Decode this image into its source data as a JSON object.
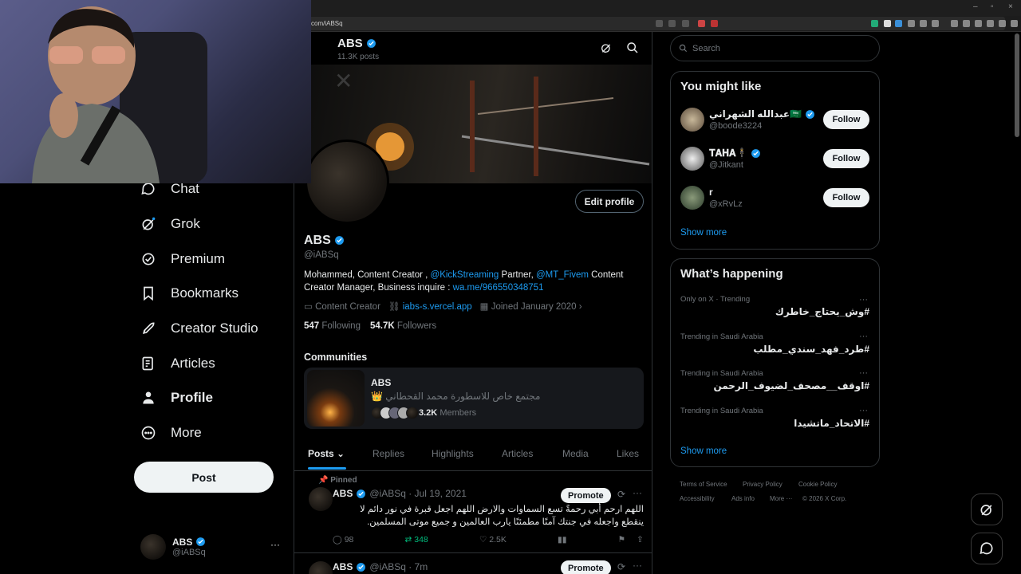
{
  "browser": {
    "url": "com/iABSq",
    "window_controls": [
      "–",
      "▫",
      "×"
    ]
  },
  "nav": {
    "items": [
      {
        "label": "Chat",
        "icon": "chat-icon"
      },
      {
        "label": "Grok",
        "icon": "grok-icon"
      },
      {
        "label": "Premium",
        "icon": "premium-icon"
      },
      {
        "label": "Bookmarks",
        "icon": "bookmark-icon"
      },
      {
        "label": "Creator Studio",
        "icon": "rocket-icon"
      },
      {
        "label": "Articles",
        "icon": "articles-icon"
      },
      {
        "label": "Profile",
        "icon": "person-icon"
      },
      {
        "label": "More",
        "icon": "more-circle-icon"
      }
    ],
    "post_label": "Post",
    "account": {
      "name": "ABS",
      "handle": "@iABSq",
      "menu": "···"
    }
  },
  "profile": {
    "header_name": "ABS",
    "header_posts": "11.3K posts",
    "name": "ABS",
    "handle": "@iABSq",
    "edit_label": "Edit profile",
    "bio_1": "Mohammed, Content Creator , ",
    "bio_link_1": "@KickStreaming",
    "bio_2": " Partner, ",
    "bio_link_2": "@MT_Fivem",
    "bio_3": " Content Creator Manager, Business inquire : ",
    "bio_link_3": "wa.me/966550348751",
    "category": "Content Creator",
    "website": "iabs-s.vercel.app",
    "joined": "Joined January 2020",
    "following_count": "547",
    "following_label": "Following",
    "followers_count": "54.7K",
    "followers_label": "Followers"
  },
  "communities": {
    "heading": "Communities",
    "name": "ABS",
    "desc": "مجتمع خاص للاسطورة محمد القحطاني 👑",
    "members_count": "3.2K",
    "members_label": "Members"
  },
  "tabs": [
    "Posts",
    "Replies",
    "Highlights",
    "Articles",
    "Media",
    "Likes"
  ],
  "pinned_tweet": {
    "pinned_label": "Pinned",
    "name": "ABS",
    "handle_date": "@iABSq · Jul 19, 2021",
    "promote_label": "Promote",
    "text": "اللهم ارحم أبي رحمةً تسع السماوات والارض اللهم اجعل قبرة في نور دائم لا ينقطع واجعله في جنتك آمنًا مطمئنًا يارب العالمين و جميع موتى المسلمين.",
    "replies": "98",
    "reposts": "348",
    "likes": "2.5K"
  },
  "second_tweet": {
    "name": "ABS",
    "handle_date": "@iABSq · 7m",
    "promote_label": "Promote"
  },
  "search": {
    "placeholder": "Search"
  },
  "you_might_like": {
    "title": "You might like",
    "users": [
      {
        "name": "عبدالله الشهراني🇸🇦",
        "handle": "@boode3224",
        "follow": "Follow"
      },
      {
        "name": "𝐓𝐀𝐇𝐀🕴️",
        "handle": "@Jitkant",
        "follow": "Follow"
      },
      {
        "name": "r",
        "handle": "@xRvLz",
        "follow": "Follow"
      }
    ],
    "show_more": "Show more"
  },
  "whats_happening": {
    "title": "What’s happening",
    "trends": [
      {
        "context": "Only on X · Trending",
        "name": "#وش_يحتاج_خاطرك"
      },
      {
        "context": "Trending in Saudi Arabia",
        "name": "#طرد_فهد_سندي_مطلب"
      },
      {
        "context": "Trending in Saudi Arabia",
        "name": "#اوقف__مصحف_لضيوف_الرحمن"
      },
      {
        "context": "Trending in Saudi Arabia",
        "name": "#الاتحاد_ماتشيدا"
      }
    ],
    "show_more": "Show more"
  },
  "footer": {
    "terms": "Terms of Service",
    "privacy": "Privacy Policy",
    "cookie": "Cookie Policy",
    "accessibility": "Accessibility",
    "ads": "Ads info",
    "more": "More ···",
    "copyright": "© 2026 X Corp."
  }
}
